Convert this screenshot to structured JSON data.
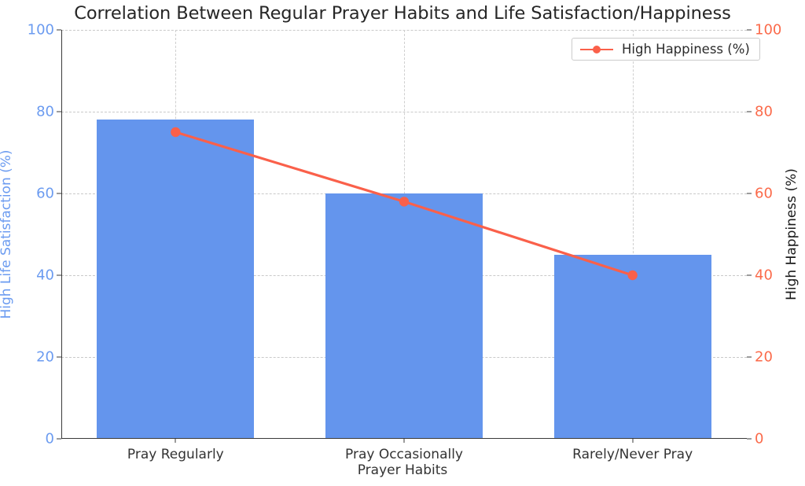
{
  "chart_data": {
    "type": "bar",
    "title": "Correlation Between Regular Prayer Habits and Life Satisfaction/Happiness",
    "xlabel": "Prayer Habits",
    "ylabel": "High Life Satisfaction (%)",
    "ylabel_right": "High Happiness (%)",
    "categories": [
      "Pray Regularly",
      "Pray Occasionally",
      "Rarely/Never Pray"
    ],
    "series": [
      {
        "name": "High Life Satisfaction (%)",
        "type": "bar",
        "axis": "left",
        "color": "#6495ed",
        "values": [
          78,
          60,
          45
        ]
      },
      {
        "name": "High Happiness (%)",
        "type": "line",
        "axis": "right",
        "color": "#fa604a",
        "marker": "circle",
        "values": [
          75,
          58,
          40
        ]
      }
    ],
    "ylim": [
      0,
      100
    ],
    "ylim_right": [
      0,
      100
    ],
    "yticks": [
      0,
      20,
      40,
      60,
      80,
      100
    ],
    "yticks_right": [
      0,
      20,
      40,
      60,
      80,
      100
    ],
    "grid": true,
    "grid_style": "dashed",
    "legend": {
      "position": "top-right",
      "entries": [
        "High Happiness (%)"
      ]
    },
    "colors": {
      "bar": "#6495ed",
      "line": "#fa604a",
      "left_axis_label": "#6b9bf0",
      "right_axis_tick": "#fb6a4a",
      "right_axis_label": "#1a1a1a",
      "title": "#262626",
      "grid": "#c9c9c9",
      "axis": "#3a3a3a",
      "background": "#ffffff"
    }
  }
}
